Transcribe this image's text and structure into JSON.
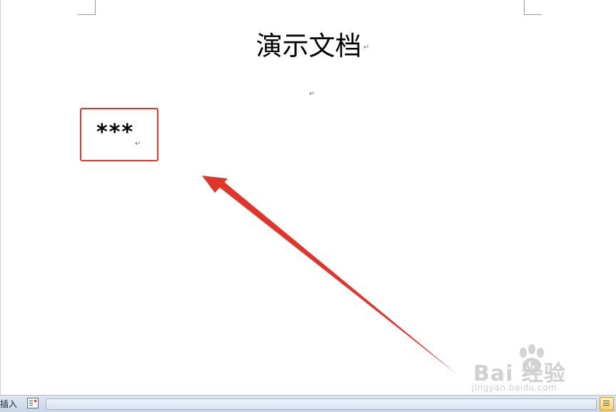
{
  "document": {
    "title": "演示文档",
    "paragraph_mark": "↵",
    "content_text": "***"
  },
  "annotation": {
    "highlight_color": "#e0352b",
    "arrow_color": "#e0352b"
  },
  "watermark": {
    "logo_text": "Bai  经验",
    "url": "jingyan.baidu.com"
  },
  "statusbar": {
    "mode_label": "插入"
  },
  "colors": {
    "statusbar_bg": "#d3dfee",
    "page_bg": "#ffffff"
  }
}
